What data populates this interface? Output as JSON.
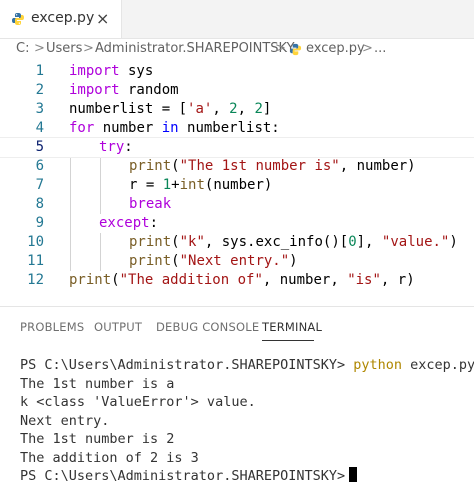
{
  "tab": {
    "filename": "excep.py",
    "close": "×"
  },
  "breadcrumb": {
    "items": [
      "C:",
      "Users",
      "Administrator.SHAREPOINTSKY",
      "excep.py",
      "..."
    ],
    "separator": ">"
  },
  "editor": {
    "lines": [
      {
        "n": "1"
      },
      {
        "n": "2"
      },
      {
        "n": "3"
      },
      {
        "n": "4"
      },
      {
        "n": "5"
      },
      {
        "n": "6"
      },
      {
        "n": "7"
      },
      {
        "n": "8"
      },
      {
        "n": "9"
      },
      {
        "n": "10"
      },
      {
        "n": "11"
      },
      {
        "n": "12"
      }
    ],
    "t": {
      "import": "import",
      "sys": " sys",
      "random": " random",
      "numberlist": "numberlist = [",
      "a": "'a'",
      "comma": ", ",
      "two": "2",
      "close": "]",
      "for": "for",
      "number_in": " number ",
      "in": "in",
      "numberlist_colon": " numberlist:",
      "try": "try",
      "colon": ":",
      "print": "print",
      "paren": "(",
      "s6": "\"The 1st number is\"",
      "s6b": ", number)",
      "r_eq": "r = ",
      "one": "1",
      "plus": "+",
      "int": "int",
      "int_arg": "(number)",
      "break": "break",
      "except": "except",
      "s10a": "\"k\"",
      "s10b": ", sys.exc_info()[",
      "zero": "0",
      "s10c": "], ",
      "s10d": "\"value.\"",
      "rparen": ")",
      "s11": "\"Next entry.\"",
      "s12a": "\"The addition of\"",
      "s12b": ", number, ",
      "s12c": "\"is\"",
      "s12d": ", r)"
    }
  },
  "panel": {
    "tabs": [
      "PROBLEMS",
      "OUTPUT",
      "DEBUG CONSOLE",
      "TERMINAL"
    ],
    "active_tab": "TERMINAL"
  },
  "terminal": {
    "prompt": "PS C:\\Users\\Administrator.SHAREPOINTSKY>",
    "command": "python",
    "arg": " excep.py",
    "output": [
      "The 1st number is a",
      "k <class 'ValueError'> value.",
      "Next entry.",
      "The 1st number is 2",
      "The addition of 2 is 3"
    ]
  },
  "colors": {
    "keyword": "#0000ff",
    "control": "#af00db",
    "string": "#a31515",
    "number": "#098658",
    "function": "#795e26",
    "line_number": "#237893"
  },
  "icons": {
    "python": "python-file-icon",
    "close": "close-icon",
    "chevron": "chevron-right-icon"
  }
}
